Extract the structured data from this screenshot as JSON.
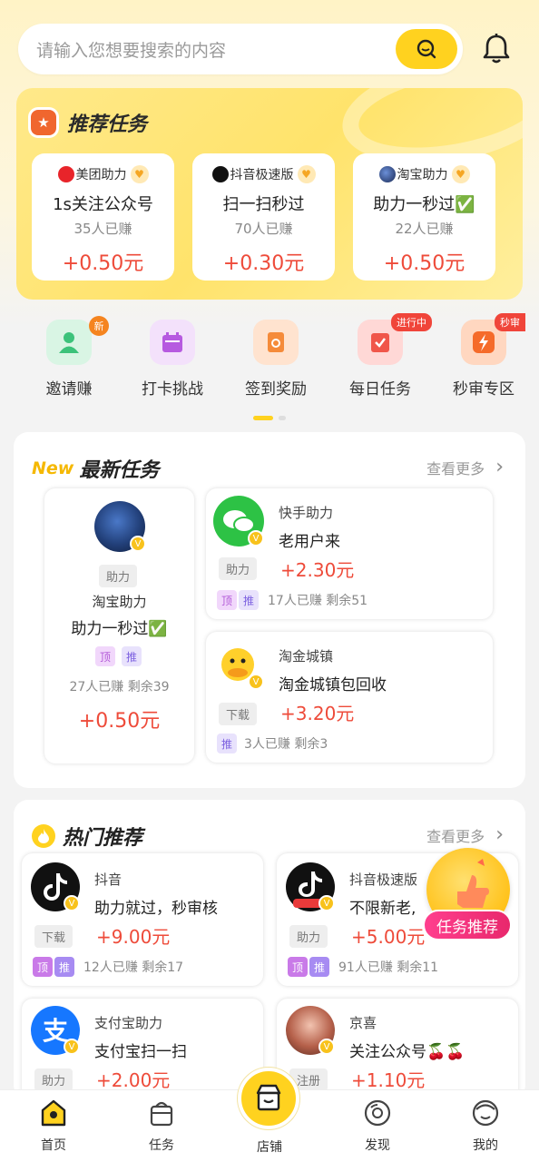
{
  "search": {
    "placeholder": "请输入您想要搜索的内容"
  },
  "recommended": {
    "title": "推荐任务",
    "cards": [
      {
        "app": "美团助力",
        "task": "1s关注公众号",
        "earned": "35人已赚",
        "price": "+0.50元"
      },
      {
        "app": "抖音极速版",
        "task": "扫一扫秒过",
        "earned": "70人已赚",
        "price": "+0.30元"
      },
      {
        "app": "淘宝助力",
        "task": "助力一秒过✅",
        "earned": "22人已赚",
        "price": "+0.50元"
      }
    ]
  },
  "quick": [
    {
      "label": "邀请赚",
      "tag": "新"
    },
    {
      "label": "打卡挑战"
    },
    {
      "label": "签到奖励"
    },
    {
      "label": "每日任务",
      "tag": "进行中"
    },
    {
      "label": "秒审专区",
      "tag": "秒审"
    }
  ],
  "latest": {
    "title": "最新任务",
    "badge": "New",
    "more": "查看更多",
    "big": {
      "chip": "助力",
      "app": "淘宝助力",
      "task": "助力一秒过✅",
      "pill1": "顶",
      "pill2": "推",
      "stats": "27人已赚 剩余39",
      "price": "+0.50元"
    },
    "items": [
      {
        "app": "快手助力",
        "task": "老用户来",
        "chip": "助力",
        "price": "+2.30元",
        "pill1": "顶",
        "pill2": "推",
        "stats": "17人已赚 剩余51"
      },
      {
        "app": "淘金城镇",
        "task": "淘金城镇包回收",
        "chip": "下载",
        "price": "+3.20元",
        "pill2": "推",
        "stats": "3人已赚 剩余3"
      }
    ]
  },
  "hot": {
    "title": "热门推荐",
    "more": "查看更多",
    "items": [
      {
        "app": "抖音",
        "task": "助力就过，秒审核",
        "chip": "下载",
        "price": "+9.00元",
        "pill1": "顶",
        "pill2": "推",
        "stats": "12人已赚 剩余17"
      },
      {
        "app": "抖音极速版",
        "task": "不限新老,",
        "chip": "助力",
        "price": "+5.00元",
        "pill1": "顶",
        "pill2": "推",
        "stats": "91人已赚 剩余11"
      },
      {
        "app": "支付宝助力",
        "task": "支付宝扫一扫",
        "chip": "助力",
        "price": "+2.00元"
      },
      {
        "app": "京喜",
        "task": "关注公众号🍒🍒",
        "chip": "注册",
        "price": "+1.10元"
      }
    ],
    "float_label": "任务推荐"
  },
  "nav": [
    {
      "label": "首页"
    },
    {
      "label": "任务"
    },
    {
      "label": "店铺"
    },
    {
      "label": "发现"
    },
    {
      "label": "我的"
    }
  ],
  "colors": {
    "accent": "#ffd21f",
    "price": "#ee4b3a"
  }
}
